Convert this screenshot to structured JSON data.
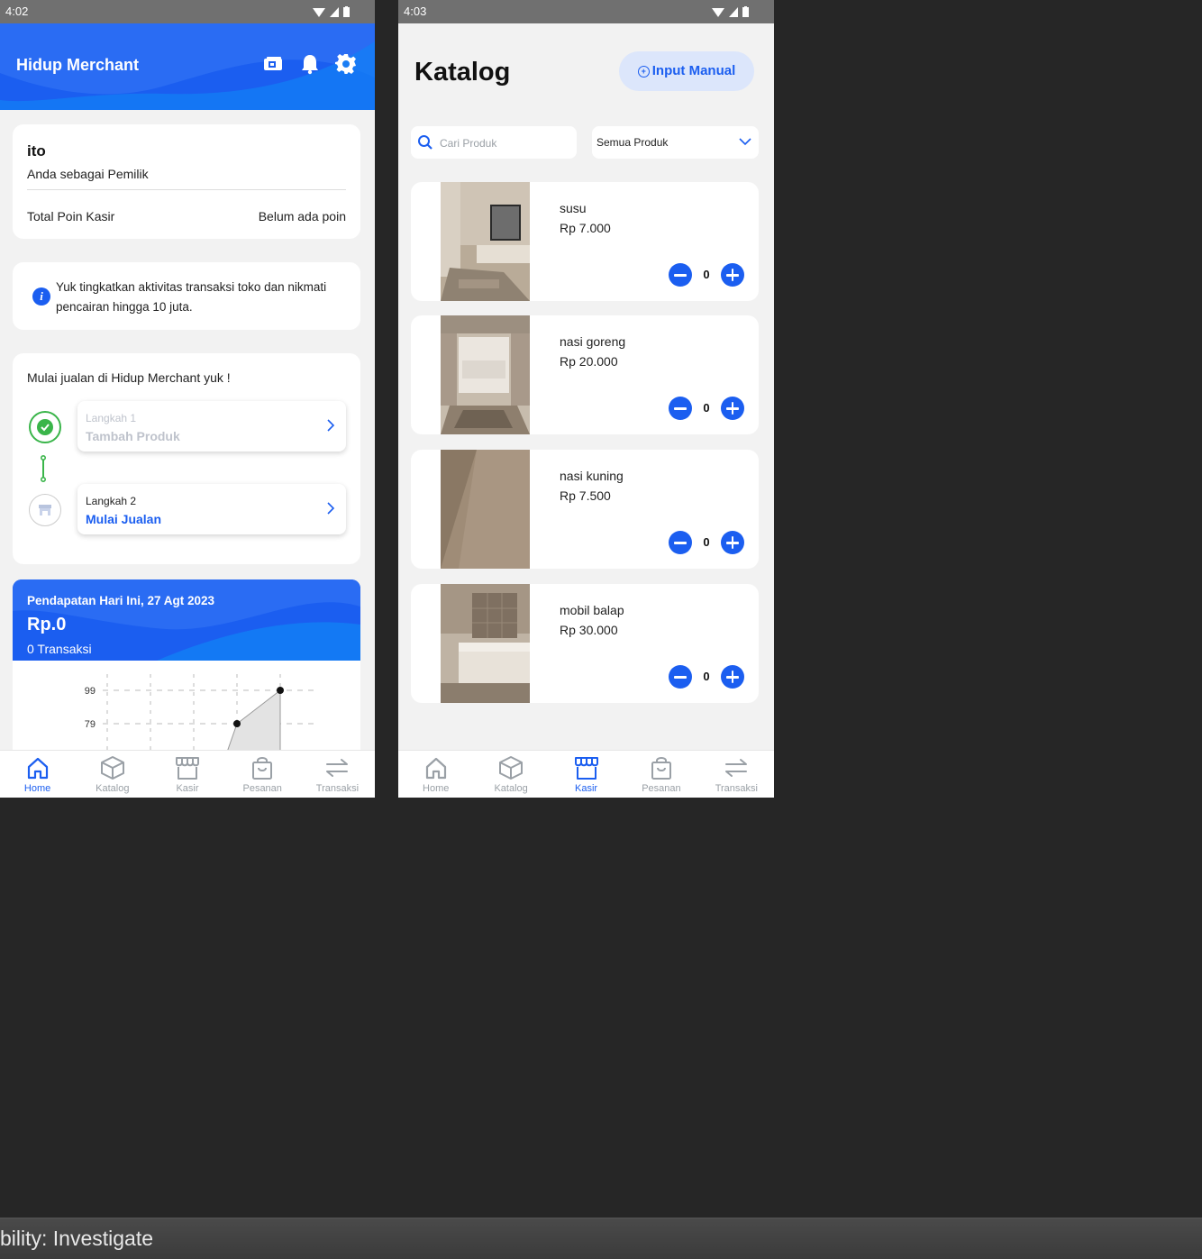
{
  "phone1": {
    "status_time": "4:02",
    "header": {
      "title": "Hidup Merchant",
      "icons": [
        "wallet-icon",
        "bell-icon",
        "gear-icon"
      ]
    },
    "user": {
      "name": "ito",
      "role": "Anda sebagai Pemilik",
      "poin_label": "Total Poin Kasir",
      "poin_value": "Belum ada poin"
    },
    "info": {
      "icon": "info-icon",
      "text": "Yuk tingkatkan aktivitas transaksi toko dan nikmati pencairan hingga 10 juta."
    },
    "steps": {
      "title": "Mulai jualan di Hidup Merchant yuk !",
      "items": [
        {
          "small": "Langkah 1",
          "big": "Tambah Produk",
          "status": "done"
        },
        {
          "small": "Langkah 2",
          "big": "Mulai Jualan",
          "status": "pending"
        }
      ]
    },
    "income": {
      "title": "Pendapatan Hari Ini, 27 Agt 2023",
      "amount": "Rp.0",
      "count": "0 Transaksi"
    },
    "chart_data": {
      "type": "area",
      "y_ticks": [
        99,
        79
      ],
      "points": [
        {
          "y": 79
        },
        {
          "y": 99
        }
      ],
      "grid": true
    },
    "nav": [
      {
        "label": "Home",
        "icon": "home-icon",
        "active": true
      },
      {
        "label": "Katalog",
        "icon": "box-icon",
        "active": false
      },
      {
        "label": "Kasir",
        "icon": "store-icon",
        "active": false
      },
      {
        "label": "Pesanan",
        "icon": "bag-icon",
        "active": false
      },
      {
        "label": "Transaksi",
        "icon": "swap-icon",
        "active": false
      }
    ]
  },
  "phone2": {
    "status_time": "4:03",
    "title": "Katalog",
    "input_manual_label": "Input Manual",
    "search": {
      "placeholder": "Cari Produk",
      "value": ""
    },
    "filter": {
      "selected": "Semua Produk"
    },
    "products": [
      {
        "name": "susu",
        "price": "Rp 7.000",
        "qty": "0"
      },
      {
        "name": "nasi goreng",
        "price": "Rp 20.000",
        "qty": "0"
      },
      {
        "name": "nasi kuning",
        "price": "Rp 7.500",
        "qty": "0"
      },
      {
        "name": "mobil balap",
        "price": "Rp 30.000",
        "qty": "0"
      }
    ],
    "nav": [
      {
        "label": "Home",
        "icon": "home-icon",
        "active": false
      },
      {
        "label": "Katalog",
        "icon": "box-icon",
        "active": false
      },
      {
        "label": "Kasir",
        "icon": "store-icon",
        "active": true
      },
      {
        "label": "Pesanan",
        "icon": "bag-icon",
        "active": false
      },
      {
        "label": "Transaksi",
        "icon": "swap-icon",
        "active": false
      }
    ]
  },
  "footer": {
    "text": "bility: Investigate"
  },
  "colors": {
    "primary": "#1b5ef0",
    "success": "#3ab54a",
    "background": "#262626"
  }
}
